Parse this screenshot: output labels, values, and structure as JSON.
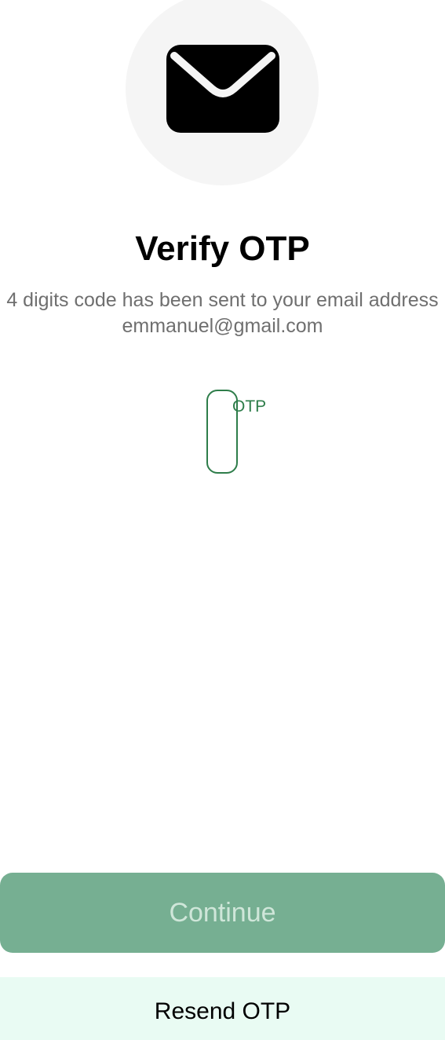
{
  "header": {
    "icon": "mail-icon",
    "title": "Verify OTP",
    "subtitle": "4 digits code has been sent to your email address",
    "email": "emmanuel@gmail.com"
  },
  "otp": {
    "label": "OTP",
    "value": ""
  },
  "actions": {
    "continue_label": "Continue",
    "resend_label": "Resend OTP"
  },
  "colors": {
    "accent": "#2e7d4a",
    "continue_bg": "#76af92",
    "resend_bg": "#e9fbf3",
    "icon_circle_bg": "#f5f5f5"
  }
}
